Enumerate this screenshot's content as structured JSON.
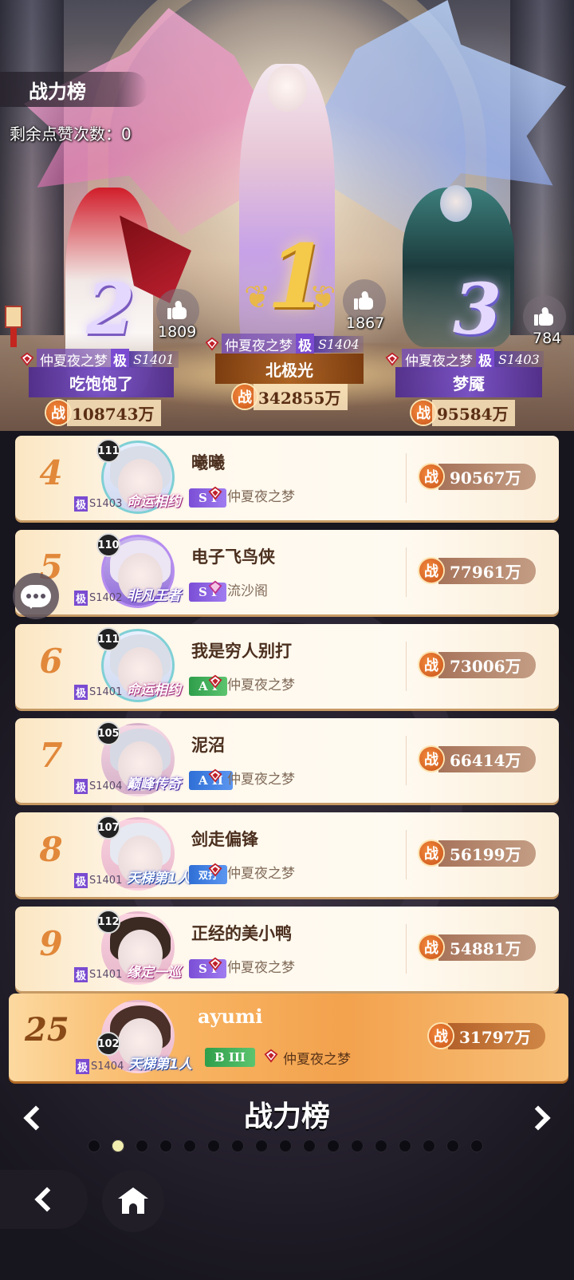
{
  "header": {
    "title": "战力榜",
    "likes_remaining_label": "剩余点赞次数：0"
  },
  "podium": [
    {
      "rank": "1",
      "name": "北极光",
      "guild": "仲夏夜之梦",
      "grade": "极",
      "season": "S1404",
      "likes": "1867",
      "power_prefix": "战",
      "power": "342855万"
    },
    {
      "rank": "2",
      "name": "吃饱饱了",
      "guild": "仲夏夜之梦",
      "grade": "极",
      "season": "S1401",
      "likes": "1809",
      "power_prefix": "战",
      "power": "108743万"
    },
    {
      "rank": "3",
      "name": "梦魇",
      "guild": "仲夏夜之梦",
      "grade": "极",
      "season": "S1403",
      "likes": "784",
      "power_prefix": "战",
      "power": "95584万"
    }
  ],
  "ranking": [
    {
      "rank": "4",
      "level": "111",
      "name": "曦曦",
      "guild": "仲夏夜之梦",
      "grade": "极",
      "season": "S1403",
      "frame_title": "命运相约",
      "tier": "S I",
      "power_prefix": "战",
      "power": "90567万"
    },
    {
      "rank": "5",
      "level": "110",
      "name": "电子飞鸟侠",
      "guild": "流沙阁",
      "grade": "极",
      "season": "S1402",
      "frame_title": "非凡王者",
      "tier": "S I",
      "power_prefix": "战",
      "power": "77961万"
    },
    {
      "rank": "6",
      "level": "111",
      "name": "我是穷人别打",
      "guild": "仲夏夜之梦",
      "grade": "极",
      "season": "S1401",
      "frame_title": "命运相约",
      "tier": "A I",
      "power_prefix": "战",
      "power": "73006万"
    },
    {
      "rank": "7",
      "level": "105",
      "name": "泥沼",
      "guild": "仲夏夜之梦",
      "grade": "极",
      "season": "S1404",
      "frame_title": "巅峰传奇",
      "tier": "A II",
      "power_prefix": "战",
      "power": "66414万"
    },
    {
      "rank": "8",
      "level": "107",
      "name": "剑走偏锋",
      "guild": "仲夏夜之梦",
      "grade": "极",
      "season": "S1401",
      "frame_title": "天梯第1人",
      "tier": "双打",
      "power_prefix": "战",
      "power": "56199万"
    },
    {
      "rank": "9",
      "level": "112",
      "name": "正经的美小鸭",
      "guild": "仲夏夜之梦",
      "grade": "极",
      "season": "S1401",
      "frame_title": "缘定一巡",
      "tier": "S I",
      "power_prefix": "战",
      "power": "54881万"
    }
  ],
  "self_row": {
    "rank": "25",
    "level": "102",
    "name": "ayumi",
    "guild": "仲夏夜之梦",
    "grade": "极",
    "season": "S1404",
    "frame_title": "天梯第1人",
    "tier": "B III",
    "power_prefix": "战",
    "power": "31797万"
  },
  "pager": {
    "title": "战力榜",
    "page_count": 17,
    "active_page": 2
  },
  "icons": [
    "thumbs-up-icon",
    "gem-icon",
    "chat-bubble-icon",
    "chevron-left-icon",
    "chevron-right-icon",
    "back-arrow-icon",
    "home-icon",
    "laurel-icon"
  ],
  "colors": {
    "gold_rank": "#f5c94a",
    "orange_rank": "#e1883a",
    "power_badge": "#e06a2a",
    "self_row": "#f3a24d",
    "active_dot": "#f2eeb0"
  }
}
